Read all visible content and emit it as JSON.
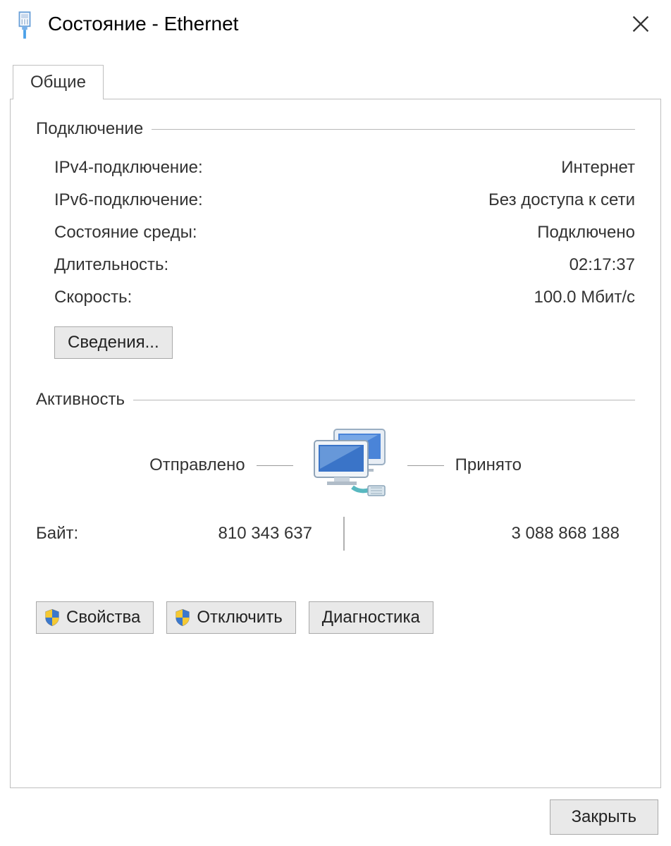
{
  "window": {
    "title": "Состояние - Ethernet"
  },
  "tabs": {
    "general": "Общие"
  },
  "connection": {
    "group_title": "Подключение",
    "ipv4_label": "IPv4-подключение:",
    "ipv4_value": "Интернет",
    "ipv6_label": "IPv6-подключение:",
    "ipv6_value": "Без доступа к сети",
    "media_label": "Состояние среды:",
    "media_value": "Подключено",
    "duration_label": "Длительность:",
    "duration_value": "02:17:37",
    "speed_label": "Скорость:",
    "speed_value": "100.0 Мбит/с",
    "details_button": "Сведения..."
  },
  "activity": {
    "group_title": "Активность",
    "sent_label": "Отправлено",
    "received_label": "Принято",
    "bytes_label": "Байт:",
    "bytes_sent": "810 343 637",
    "bytes_received": "3 088 868 188"
  },
  "buttons": {
    "properties": "Свойства",
    "disable": "Отключить",
    "diagnose": "Диагностика",
    "close": "Закрыть"
  }
}
